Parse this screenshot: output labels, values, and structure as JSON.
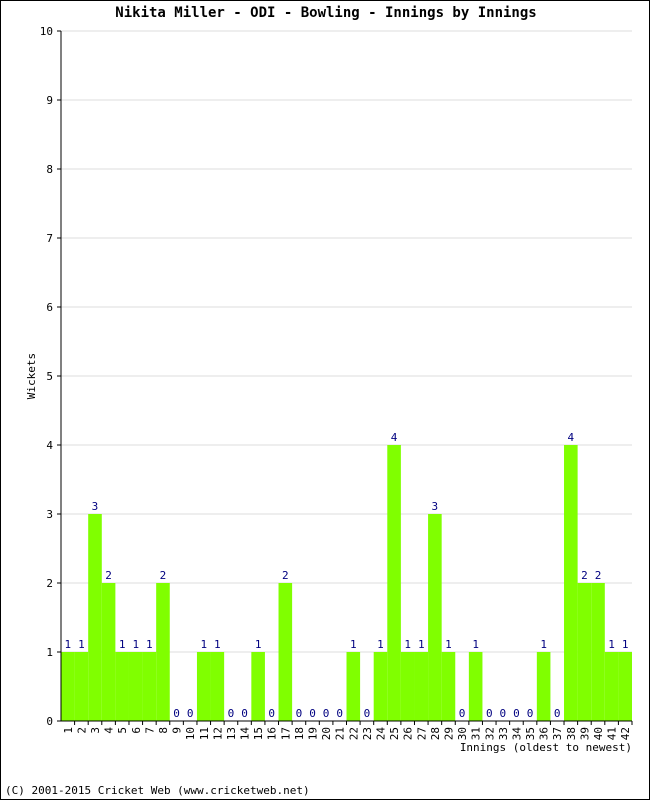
{
  "chart_data": {
    "type": "bar",
    "title": "Nikita Miller - ODI - Bowling - Innings by Innings",
    "xlabel": "Innings (oldest to newest)",
    "ylabel": "Wickets",
    "ylim": [
      0,
      10
    ],
    "yticks": [
      0,
      1,
      2,
      3,
      4,
      5,
      6,
      7,
      8,
      9,
      10
    ],
    "grid": true,
    "bar_color": "#80ff00",
    "label_color": "#000080",
    "categories": [
      "1",
      "2",
      "3",
      "4",
      "5",
      "6",
      "7",
      "8",
      "9",
      "10",
      "11",
      "12",
      "13",
      "14",
      "15",
      "16",
      "17",
      "18",
      "19",
      "20",
      "21",
      "22",
      "23",
      "24",
      "25",
      "26",
      "27",
      "28",
      "29",
      "30",
      "31",
      "32",
      "33",
      "34",
      "35",
      "36",
      "37",
      "38",
      "39",
      "40",
      "41",
      "42"
    ],
    "values": [
      1,
      1,
      3,
      2,
      1,
      1,
      1,
      2,
      0,
      0,
      1,
      1,
      0,
      0,
      1,
      0,
      2,
      0,
      0,
      0,
      0,
      1,
      0,
      1,
      4,
      1,
      1,
      3,
      1,
      0,
      1,
      0,
      0,
      0,
      0,
      1,
      0,
      4,
      2,
      2,
      1,
      1
    ]
  },
  "footer": {
    "copyright": "(C) 2001-2015 Cricket Web (www.cricketweb.net)"
  }
}
